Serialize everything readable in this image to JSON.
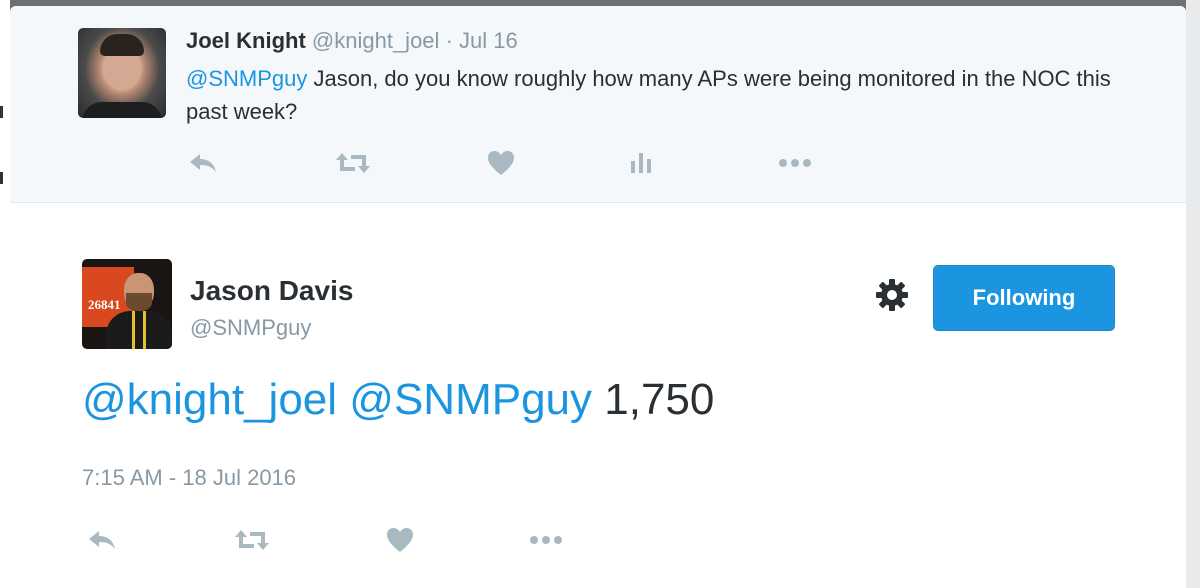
{
  "parent_tweet": {
    "name": "Joel Knight",
    "handle": "@knight_joel",
    "separator": "·",
    "date": "Jul 16",
    "mention": "@SNMPguy",
    "text": " Jason, do you know roughly how many APs were being monitored in the NOC this past week?",
    "actions": [
      "reply-icon",
      "retweet-icon",
      "like-icon",
      "analytics-icon",
      "more-icon"
    ]
  },
  "main_tweet": {
    "name": "Jason Davis",
    "handle": "@SNMPguy",
    "follow_button": "Following",
    "settings_icon": "gear-icon",
    "mention_1": "@knight_joel",
    "mention_2": "@SNMPguy",
    "text_value": "1,750",
    "timestamp": "7:15 AM - 18 Jul 2016",
    "avatar_screen_text": "26841",
    "actions": [
      "reply-icon",
      "retweet-icon",
      "like-icon",
      "more-icon"
    ]
  },
  "colors": {
    "accent": "#1b95e0",
    "icon_gray": "#aab8c2",
    "muted_text": "#8899a6",
    "body_text": "#292f33",
    "parent_bg": "#f5f8fa"
  }
}
